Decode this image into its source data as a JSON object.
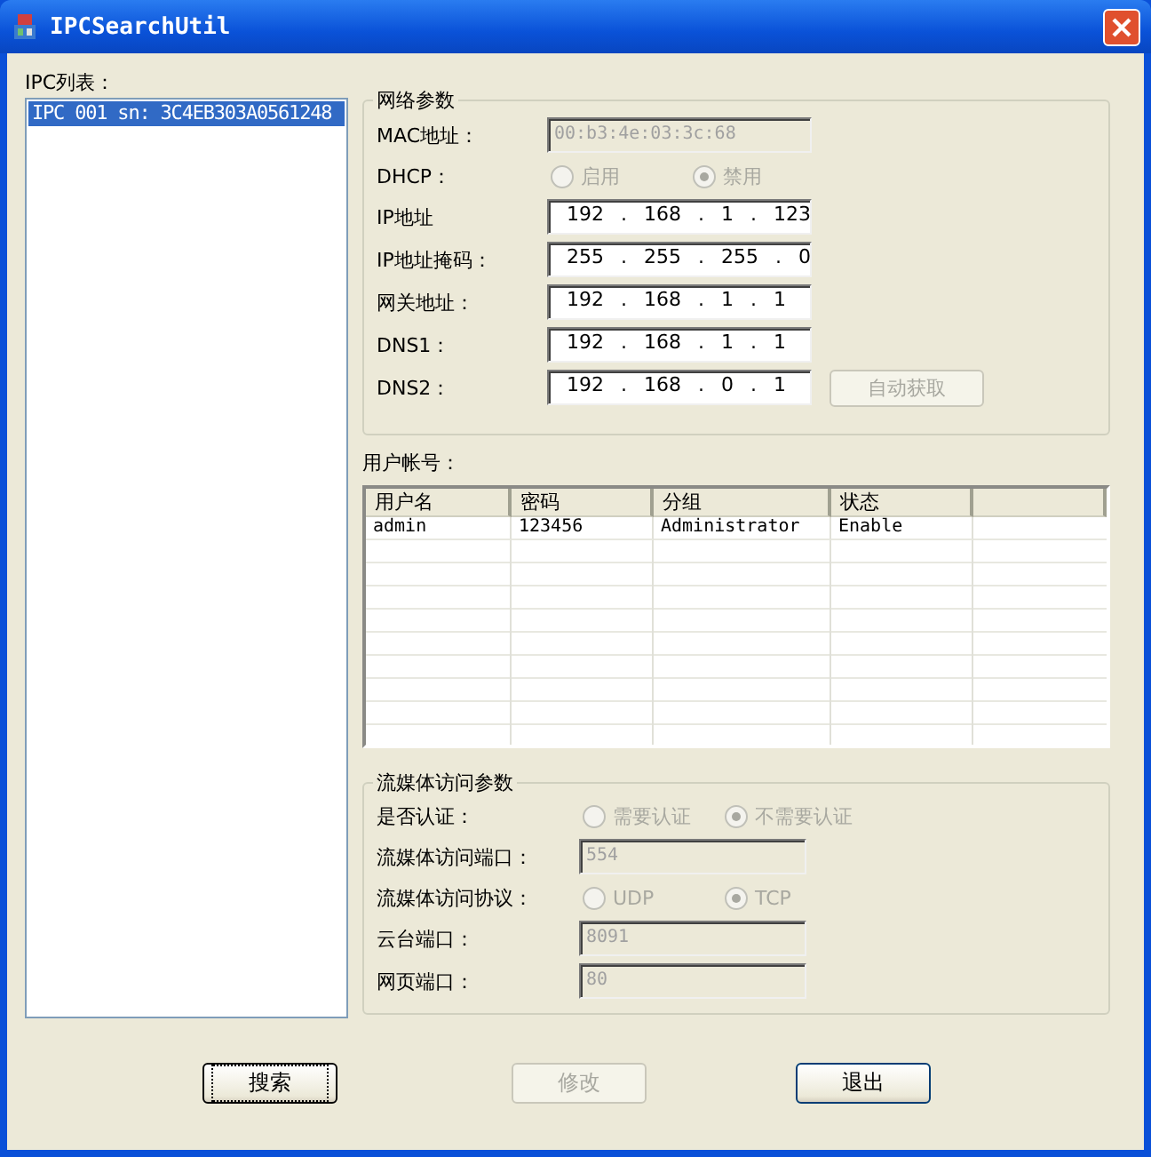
{
  "window": {
    "title": "IPCSearchUtil"
  },
  "ipc_list": {
    "label": "IPC列表：",
    "items": [
      {
        "text": "IPC 001 sn: 3C4EB303A0561248",
        "selected": true
      }
    ]
  },
  "network": {
    "title": "网络参数",
    "rows": [
      {
        "kind": "text",
        "label": "MAC地址：",
        "value": "00:b3:4e:03:3c:68",
        "disabled": true
      },
      {
        "kind": "radio",
        "label": "DHCP：",
        "disabled": true,
        "options": [
          {
            "label": "启用",
            "selected": false
          },
          {
            "label": "禁用",
            "selected": true
          }
        ]
      },
      {
        "kind": "ip",
        "label": "IP地址",
        "value": "192 . 168 . 1 . 123"
      },
      {
        "kind": "ip",
        "label": "IP地址掩码：",
        "value": "255 . 255 . 255 . 0"
      },
      {
        "kind": "ip",
        "label": "网关地址：",
        "value": "192 . 168 . 1 . 1"
      },
      {
        "kind": "ip",
        "label": "DNS1：",
        "value": "192 . 168 . 1 . 1"
      },
      {
        "kind": "ip",
        "label": "DNS2：",
        "value": "192 . 168 . 0 . 1"
      }
    ],
    "auto_button": {
      "label": "自动获取",
      "disabled": true
    }
  },
  "accounts": {
    "label": "用户帐号：",
    "columns": [
      "用户名",
      "密码",
      "分组",
      "状态"
    ],
    "rows": [
      [
        "admin",
        "123456",
        "Administrator",
        "Enable"
      ]
    ]
  },
  "stream": {
    "title": "流媒体访问参数",
    "rows": [
      {
        "kind": "radio",
        "label": "是否认证：",
        "disabled": true,
        "options": [
          {
            "label": "需要认证",
            "selected": false
          },
          {
            "label": "不需要认证",
            "selected": true
          }
        ]
      },
      {
        "kind": "text",
        "label": "流媒体访问端口：",
        "value": "554",
        "disabled": true
      },
      {
        "kind": "radio",
        "label": "流媒体访问协议：",
        "disabled": true,
        "options": [
          {
            "label": "UDP",
            "selected": false
          },
          {
            "label": "TCP",
            "selected": true
          }
        ]
      },
      {
        "kind": "text",
        "label": "云台端口：",
        "value": "8091",
        "disabled": true
      },
      {
        "kind": "text",
        "label": "网页端口：",
        "value": "80",
        "disabled": true
      }
    ]
  },
  "buttons": [
    {
      "label": "搜索",
      "disabled": false,
      "focused": true
    },
    {
      "label": "修改",
      "disabled": true,
      "focused": false
    },
    {
      "label": "退出",
      "disabled": false,
      "focused": false
    }
  ]
}
